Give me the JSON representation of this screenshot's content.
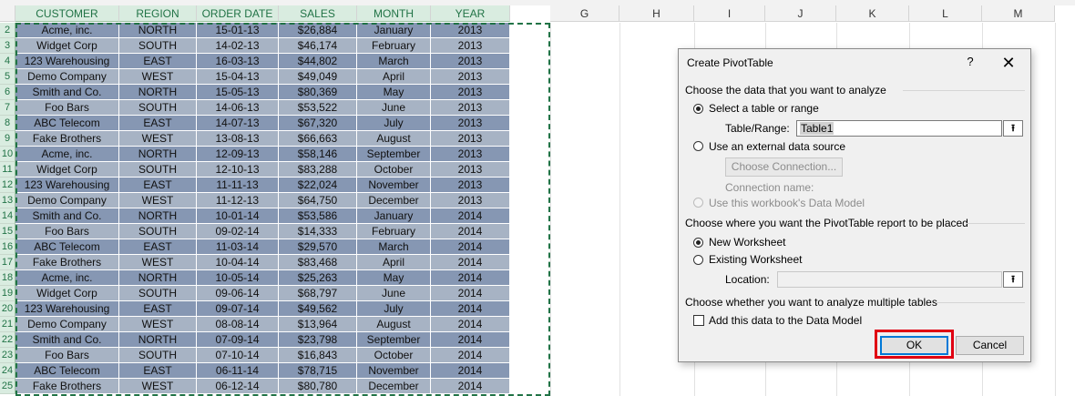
{
  "columns": [
    "CUSTOMER",
    "REGION",
    "ORDER DATE",
    "SALES",
    "MONTH",
    "YEAR"
  ],
  "empty_columns": [
    "G",
    "H",
    "I",
    "J",
    "K",
    "L",
    "M"
  ],
  "rows": [
    {
      "n": "2",
      "c": [
        "Acme, inc.",
        "NORTH",
        "15-01-13",
        "$26,884",
        "January",
        "2013"
      ]
    },
    {
      "n": "3",
      "c": [
        "Widget Corp",
        "SOUTH",
        "14-02-13",
        "$46,174",
        "February",
        "2013"
      ]
    },
    {
      "n": "4",
      "c": [
        "123 Warehousing",
        "EAST",
        "16-03-13",
        "$44,802",
        "March",
        "2013"
      ]
    },
    {
      "n": "5",
      "c": [
        "Demo Company",
        "WEST",
        "15-04-13",
        "$49,049",
        "April",
        "2013"
      ]
    },
    {
      "n": "6",
      "c": [
        "Smith and Co.",
        "NORTH",
        "15-05-13",
        "$80,369",
        "May",
        "2013"
      ]
    },
    {
      "n": "7",
      "c": [
        "Foo Bars",
        "SOUTH",
        "14-06-13",
        "$53,522",
        "June",
        "2013"
      ]
    },
    {
      "n": "8",
      "c": [
        "ABC Telecom",
        "EAST",
        "14-07-13",
        "$67,320",
        "July",
        "2013"
      ]
    },
    {
      "n": "9",
      "c": [
        "Fake Brothers",
        "WEST",
        "13-08-13",
        "$66,663",
        "August",
        "2013"
      ]
    },
    {
      "n": "10",
      "c": [
        "Acme, inc.",
        "NORTH",
        "12-09-13",
        "$58,146",
        "September",
        "2013"
      ]
    },
    {
      "n": "11",
      "c": [
        "Widget Corp",
        "SOUTH",
        "12-10-13",
        "$83,288",
        "October",
        "2013"
      ]
    },
    {
      "n": "12",
      "c": [
        "123 Warehousing",
        "EAST",
        "11-11-13",
        "$22,024",
        "November",
        "2013"
      ]
    },
    {
      "n": "13",
      "c": [
        "Demo Company",
        "WEST",
        "11-12-13",
        "$64,750",
        "December",
        "2013"
      ]
    },
    {
      "n": "14",
      "c": [
        "Smith and Co.",
        "NORTH",
        "10-01-14",
        "$53,586",
        "January",
        "2014"
      ]
    },
    {
      "n": "15",
      "c": [
        "Foo Bars",
        "SOUTH",
        "09-02-14",
        "$14,333",
        "February",
        "2014"
      ]
    },
    {
      "n": "16",
      "c": [
        "ABC Telecom",
        "EAST",
        "11-03-14",
        "$29,570",
        "March",
        "2014"
      ]
    },
    {
      "n": "17",
      "c": [
        "Fake Brothers",
        "WEST",
        "10-04-14",
        "$83,468",
        "April",
        "2014"
      ]
    },
    {
      "n": "18",
      "c": [
        "Acme, inc.",
        "NORTH",
        "10-05-14",
        "$25,263",
        "May",
        "2014"
      ]
    },
    {
      "n": "19",
      "c": [
        "Widget Corp",
        "SOUTH",
        "09-06-14",
        "$68,797",
        "June",
        "2014"
      ]
    },
    {
      "n": "20",
      "c": [
        "123 Warehousing",
        "EAST",
        "09-07-14",
        "$49,562",
        "July",
        "2014"
      ]
    },
    {
      "n": "21",
      "c": [
        "Demo Company",
        "WEST",
        "08-08-14",
        "$13,964",
        "August",
        "2014"
      ]
    },
    {
      "n": "22",
      "c": [
        "Smith and Co.",
        "NORTH",
        "07-09-14",
        "$23,798",
        "September",
        "2014"
      ]
    },
    {
      "n": "23",
      "c": [
        "Foo Bars",
        "SOUTH",
        "07-10-14",
        "$16,843",
        "October",
        "2014"
      ]
    },
    {
      "n": "24",
      "c": [
        "ABC Telecom",
        "EAST",
        "06-11-14",
        "$78,715",
        "November",
        "2014"
      ]
    },
    {
      "n": "25",
      "c": [
        "Fake Brothers",
        "WEST",
        "06-12-14",
        "$80,780",
        "December",
        "2014"
      ]
    }
  ],
  "dialog": {
    "title": "Create PivotTable",
    "help": "?",
    "close": "✕",
    "section1": "Choose the data that you want to analyze",
    "opt_table": "Select a table or range",
    "table_range_label": "Table/Range:",
    "table_range_value": "Table1",
    "ref_icon": "⭱",
    "opt_external": "Use an external data source",
    "choose_connection": "Choose Connection...",
    "connection_name": "Connection name:",
    "opt_data_model": "Use this workbook's Data Model",
    "section2": "Choose where you want the PivotTable report to be placed",
    "opt_new_ws": "New Worksheet",
    "opt_existing_ws": "Existing Worksheet",
    "location_label": "Location:",
    "location_value": "",
    "section3": "Choose whether you want to analyze multiple tables",
    "add_data_model": "Add this data to the Data Model",
    "ok": "OK",
    "cancel": "Cancel"
  },
  "colors": {
    "accent_green": "#217346",
    "band_dark": "#8697b3",
    "band_light": "#a7b3c4",
    "highlight_red": "#e00012"
  }
}
